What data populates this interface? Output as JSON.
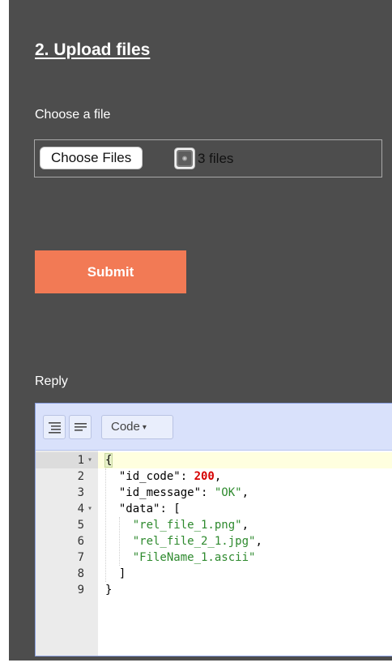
{
  "section": {
    "title": "2. Upload files"
  },
  "upload": {
    "label": "Choose a file",
    "choose_button": "Choose Files",
    "file_count": "3 files",
    "thumb_icon": "image-thumbnail-icon"
  },
  "submit": {
    "label": "Submit",
    "color": "#f27a55"
  },
  "reply": {
    "label": "Reply",
    "toolbar": {
      "format_icon": "format-json-icon",
      "compact_icon": "compact-json-icon",
      "mode_label": "Code",
      "mode_caret": "▾"
    },
    "lines": [
      {
        "n": "1",
        "fold": "▾",
        "tokens": [
          {
            "t": "bracket",
            "v": "{"
          }
        ]
      },
      {
        "n": "2",
        "fold": "",
        "tokens": [
          {
            "t": "plain",
            "v": "  "
          },
          {
            "t": "key",
            "v": "\"id_code\""
          },
          {
            "t": "punc",
            "v": ": "
          },
          {
            "t": "num",
            "v": "200"
          },
          {
            "t": "punc",
            "v": ","
          }
        ]
      },
      {
        "n": "3",
        "fold": "",
        "tokens": [
          {
            "t": "plain",
            "v": "  "
          },
          {
            "t": "key",
            "v": "\"id_message\""
          },
          {
            "t": "punc",
            "v": ": "
          },
          {
            "t": "str",
            "v": "\"OK\""
          },
          {
            "t": "punc",
            "v": ","
          }
        ]
      },
      {
        "n": "4",
        "fold": "▾",
        "tokens": [
          {
            "t": "plain",
            "v": "  "
          },
          {
            "t": "key",
            "v": "\"data\""
          },
          {
            "t": "punc",
            "v": ": ["
          }
        ]
      },
      {
        "n": "5",
        "fold": "",
        "tokens": [
          {
            "t": "plain",
            "v": "    "
          },
          {
            "t": "str",
            "v": "\"rel_file_1.png\""
          },
          {
            "t": "punc",
            "v": ","
          }
        ]
      },
      {
        "n": "6",
        "fold": "",
        "tokens": [
          {
            "t": "plain",
            "v": "    "
          },
          {
            "t": "str",
            "v": "\"rel_file_2_1.jpg\""
          },
          {
            "t": "punc",
            "v": ","
          }
        ]
      },
      {
        "n": "7",
        "fold": "",
        "tokens": [
          {
            "t": "plain",
            "v": "    "
          },
          {
            "t": "str",
            "v": "\"FileName_1.ascii\""
          }
        ]
      },
      {
        "n": "8",
        "fold": "",
        "tokens": [
          {
            "t": "plain",
            "v": "  "
          },
          {
            "t": "punc",
            "v": "]"
          }
        ]
      },
      {
        "n": "9",
        "fold": "",
        "tokens": [
          {
            "t": "punc",
            "v": "}"
          }
        ]
      }
    ],
    "active_line": 1
  }
}
